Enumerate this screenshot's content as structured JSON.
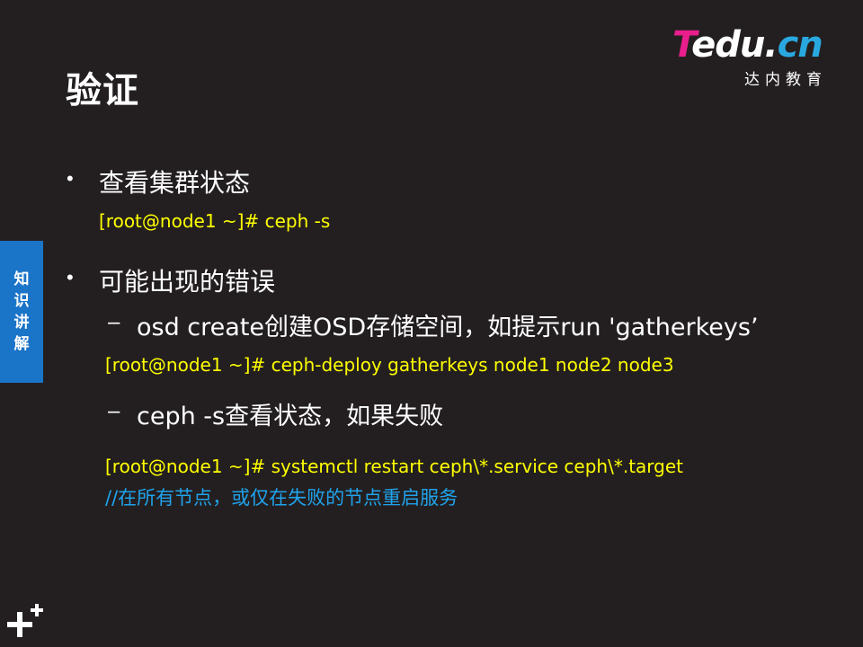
{
  "title": "验证",
  "logo": {
    "t": "T",
    "edu": "edu.",
    "cn": "cn",
    "sub": "达内教育"
  },
  "side_tab": [
    "知",
    "识",
    "讲",
    "解"
  ],
  "bullets": [
    {
      "text": "查看集群状态",
      "command": "[root@node1 ~]#  ceph  -s"
    },
    {
      "text": "可能出现的错误",
      "subitems": [
        {
          "text": "osd create创建OSD存储空间，如提示run 'gatherkeys’",
          "command": "[root@node1 ~]#  ceph-deploy gatherkeys node1 node2 node3"
        },
        {
          "text": "ceph -s查看状态，如果失败",
          "command": "[root@node1 ~]#  systemctl restart ceph\\*.service ceph\\*.target",
          "comment": "//在所有节点，或仅在失败的节点重启服务"
        }
      ]
    }
  ],
  "colors": {
    "background": "#231f20",
    "command": "#ffff00",
    "comment": "#1fa3ec",
    "side_tab": "#1a74c8"
  },
  "icons": [
    "plus-decor-icon"
  ]
}
